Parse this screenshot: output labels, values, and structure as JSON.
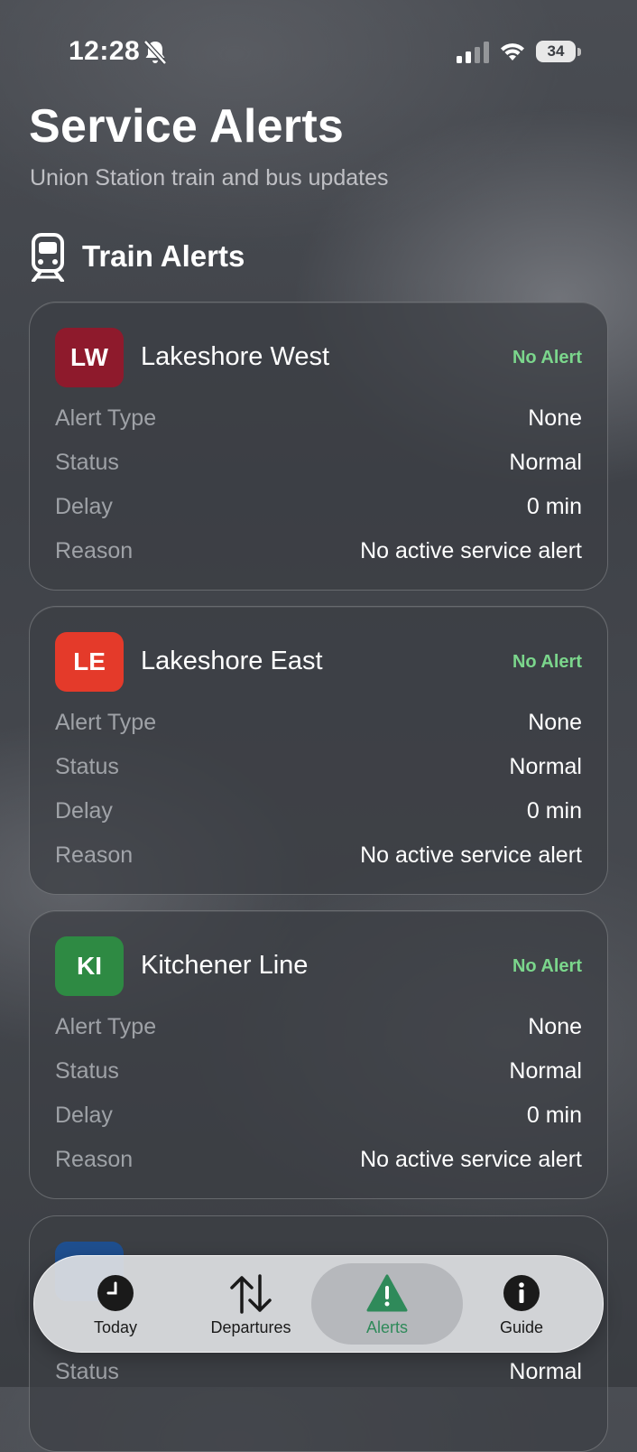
{
  "status_bar": {
    "time": "12:28",
    "battery": "34"
  },
  "header": {
    "title": "Service Alerts",
    "subtitle": "Union Station train and bus updates"
  },
  "section": {
    "icon": "train-icon",
    "title": "Train Alerts"
  },
  "row_labels": {
    "alert_type": "Alert Type",
    "status": "Status",
    "delay": "Delay",
    "reason": "Reason"
  },
  "cards": [
    {
      "badge": "LW",
      "badge_color": "#8e1a2c",
      "name": "Lakeshore West",
      "alert": "No Alert",
      "alert_type": "None",
      "status": "Normal",
      "delay": "0 min",
      "reason": "No active service alert"
    },
    {
      "badge": "LE",
      "badge_color": "#e43a2a",
      "name": "Lakeshore East",
      "alert": "No Alert",
      "alert_type": "None",
      "status": "Normal",
      "delay": "0 min",
      "reason": "No active service alert"
    },
    {
      "badge": "KI",
      "badge_color": "#2e8a43",
      "name": "Kitchener Line",
      "alert": "No Alert",
      "alert_type": "None",
      "status": "Normal",
      "delay": "0 min",
      "reason": "No active service alert"
    }
  ],
  "partial_card": {
    "status_label": "Status",
    "status_value": "Normal"
  },
  "tabs": [
    {
      "label": "Today",
      "icon": "clock-icon"
    },
    {
      "label": "Departures",
      "icon": "arrows-up-down-icon"
    },
    {
      "label": "Alerts",
      "icon": "warning-triangle-icon",
      "active": true
    },
    {
      "label": "Guide",
      "icon": "info-circle-icon"
    }
  ],
  "colors": {
    "no_alert": "#7bd68c",
    "active_tab": "#2f8a5a"
  }
}
